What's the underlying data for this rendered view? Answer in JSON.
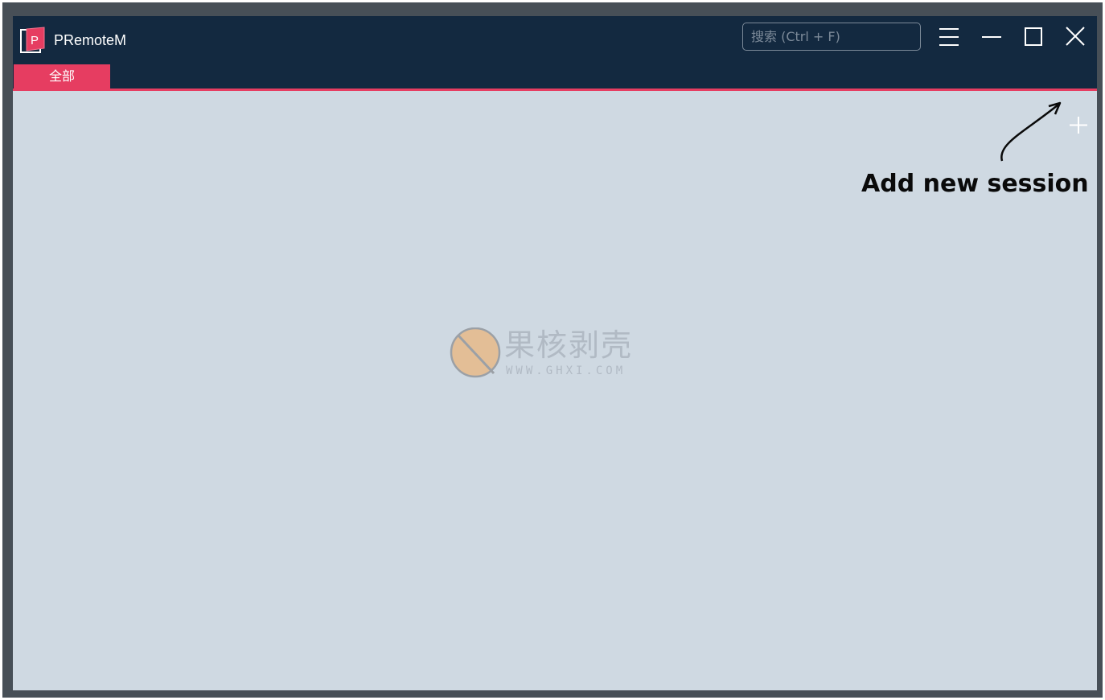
{
  "app": {
    "title": "PRemoteM",
    "logo_letter": "P"
  },
  "search": {
    "placeholder": "搜索 (Ctrl + F)"
  },
  "window_controls": {
    "icons": [
      "menu-icon",
      "minimize-icon",
      "maximize-icon",
      "close-icon"
    ]
  },
  "tabs": [
    {
      "label": "全部",
      "active": true
    }
  ],
  "toolbar": {
    "add_icon": "plus-icon"
  },
  "annotation": {
    "text": "Add new session"
  },
  "watermark": {
    "brand": "果核剥壳",
    "url": "WWW.GHXI.COM"
  },
  "colors": {
    "titlebar": "#132940",
    "accent": "#e63d61",
    "content_bg": "#cfd9e2",
    "frame": "#474f57"
  }
}
